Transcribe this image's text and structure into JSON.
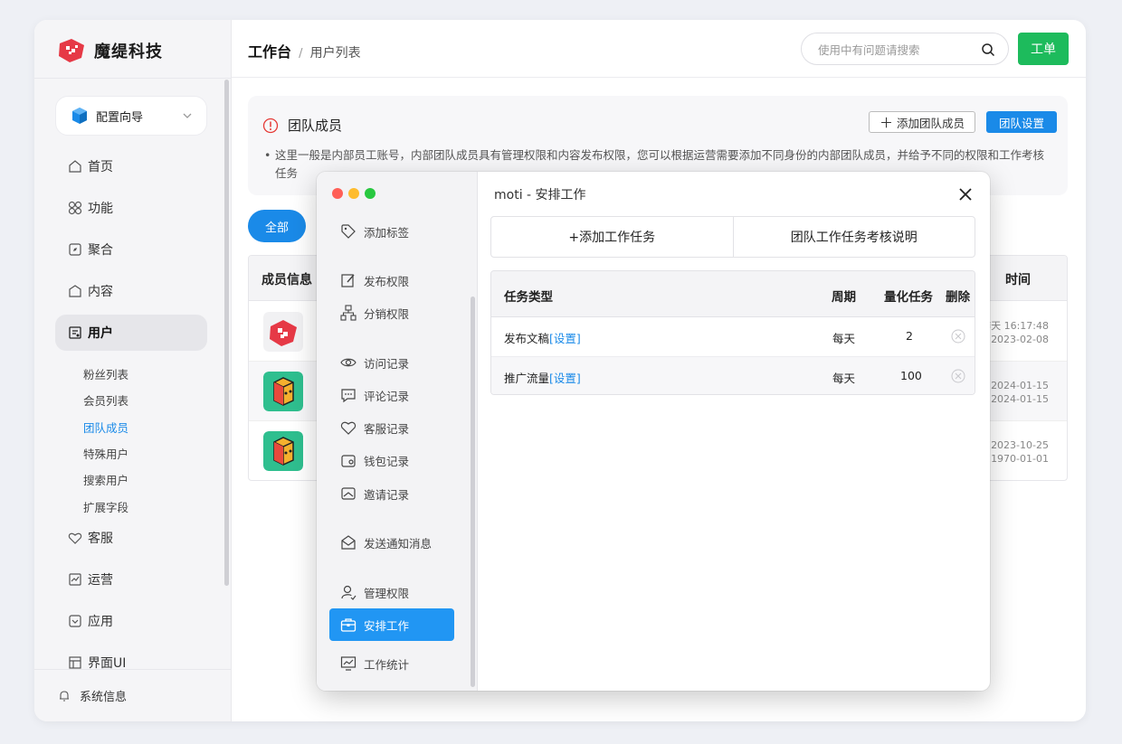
{
  "brand": {
    "name": "魔缇科技",
    "logo_color": "#e63946"
  },
  "sidebar": {
    "wizard_label": "配置向导",
    "items": [
      {
        "label": "首页",
        "icon": "home-icon"
      },
      {
        "label": "功能",
        "icon": "apps-icon"
      },
      {
        "label": "聚合",
        "icon": "compass-icon"
      },
      {
        "label": "内容",
        "icon": "content-icon"
      },
      {
        "label": "用户",
        "icon": "user-list-icon",
        "active": true
      },
      {
        "label": "客服",
        "icon": "heart-icon"
      },
      {
        "label": "运营",
        "icon": "chart-icon"
      },
      {
        "label": "应用",
        "icon": "app-icon"
      },
      {
        "label": "界面UI",
        "icon": "grid-icon"
      }
    ],
    "subitems": [
      {
        "label": "粉丝列表"
      },
      {
        "label": "会员列表"
      },
      {
        "label": "团队成员",
        "active": true
      },
      {
        "label": "特殊用户"
      },
      {
        "label": "搜索用户"
      },
      {
        "label": "扩展字段"
      }
    ],
    "system_label": "系统信息"
  },
  "header": {
    "breadcrumb_main": "工作台",
    "breadcrumb_sep": "/",
    "breadcrumb_sub": "用户列表",
    "search_placeholder": "使用中有问题请搜索",
    "ticket_label": "工单"
  },
  "team": {
    "title": "团队成员",
    "add_label": "添加团队成员",
    "settings_label": "团队设置",
    "description": "这里一般是内部员工账号，内部团队成员具有管理权限和内容发布权限，您可以根据运营需要添加不同身份的内部团队成员，并给予不同的权限和工作考核任务"
  },
  "filter": {
    "all_label": "全部"
  },
  "members_table": {
    "col_member": "成员信息",
    "col_time": "时间",
    "rows": [
      {
        "avatar": "moti-logo",
        "time1": "昨天 16:17:48",
        "time2": "2023-02-08"
      },
      {
        "avatar": "robot-cube",
        "time1": "2024-01-15",
        "time2": "2024-01-15"
      },
      {
        "avatar": "robot-cube",
        "time1": "2023-10-25",
        "time2": "1970-01-01"
      }
    ]
  },
  "modal": {
    "title": "moti - 安排工作",
    "menu": [
      {
        "label": "添加标签",
        "icon": "tag-icon"
      },
      {
        "label": "发布权限",
        "icon": "edit-icon"
      },
      {
        "label": "分销权限",
        "icon": "distribution-icon"
      },
      {
        "label": "访问记录",
        "icon": "eye-icon"
      },
      {
        "label": "评论记录",
        "icon": "comment-icon"
      },
      {
        "label": "客服记录",
        "icon": "heart-icon"
      },
      {
        "label": "钱包记录",
        "icon": "wallet-icon"
      },
      {
        "label": "邀请记录",
        "icon": "invite-icon"
      },
      {
        "label": "发送通知消息",
        "icon": "mail-icon"
      },
      {
        "label": "管理权限",
        "icon": "admin-icon"
      },
      {
        "label": "安排工作",
        "icon": "briefcase-icon",
        "active": true
      },
      {
        "label": "工作统计",
        "icon": "stats-icon"
      }
    ],
    "tabs": [
      {
        "label": "+添加工作任务"
      },
      {
        "label": "团队工作任务考核说明"
      }
    ],
    "task_table": {
      "headers": {
        "type": "任务类型",
        "period": "周期",
        "quota": "量化任务",
        "delete": "删除"
      },
      "set_label": "[设置]",
      "rows": [
        {
          "type": "发布文稿",
          "period": "每天",
          "quota": "2"
        },
        {
          "type": "推广流量",
          "period": "每天",
          "quota": "100"
        }
      ]
    }
  },
  "colors": {
    "accent": "#1a8ae8",
    "ticket_green": "#1dbb5c",
    "active_blue": "#2196f3"
  }
}
